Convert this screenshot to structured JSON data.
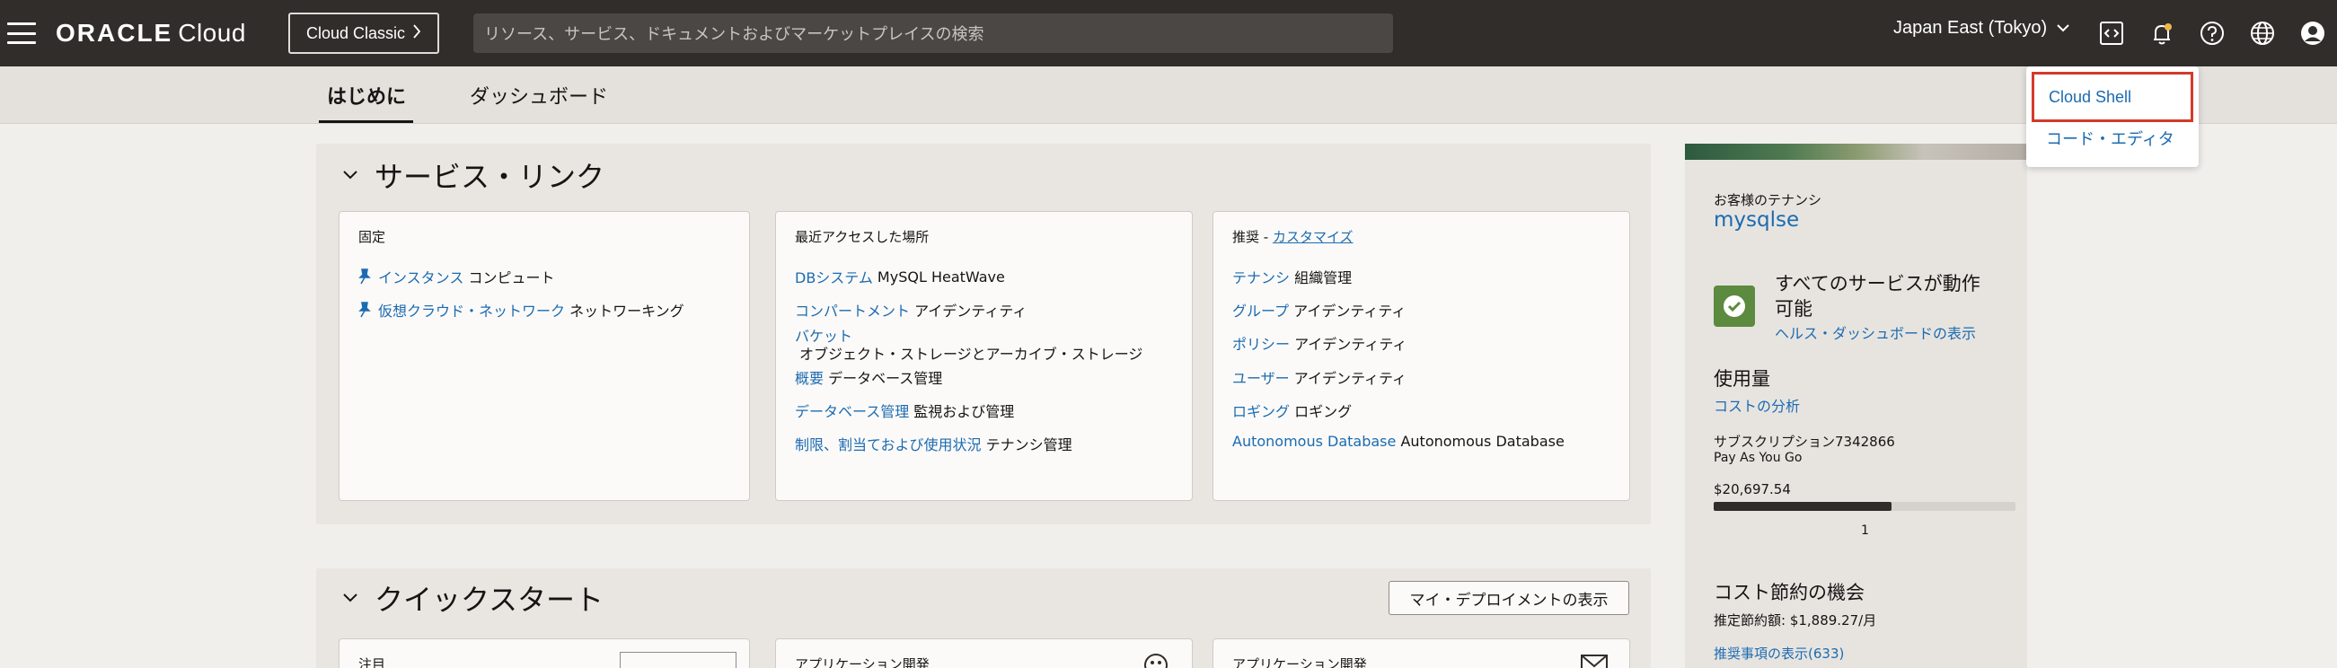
{
  "header": {
    "logo_oracle": "ORACLE",
    "logo_cloud": "Cloud",
    "classic_button": "Cloud Classic",
    "search_placeholder": "リソース、サービス、ドキュメントおよびマーケットプレイスの検索",
    "region": "Japan East (Tokyo)"
  },
  "tabs": [
    {
      "label": "はじめに",
      "active": true
    },
    {
      "label": "ダッシュボード",
      "active": false
    }
  ],
  "service_links": {
    "title": "サービス・リンク",
    "pinned": {
      "header": "固定",
      "items": [
        {
          "link": "インスタンス",
          "category": "コンピュート"
        },
        {
          "link": "仮想クラウド・ネットワーク",
          "category": "ネットワーキング"
        }
      ]
    },
    "recent": {
      "header": "最近アクセスした場所",
      "items": [
        {
          "link": "DBシステム",
          "category": "MySQL HeatWave"
        },
        {
          "link": "コンパートメント",
          "category": "アイデンティティ"
        },
        {
          "link": "バケット",
          "category": "オブジェクト・ストレージとアーカイブ・ストレージ"
        },
        {
          "link": "概要",
          "category": "データベース管理"
        },
        {
          "link": "データベース管理",
          "category": "監視および管理"
        },
        {
          "link": "制限、割当ておよび使用状況",
          "category": "テナンシ管理"
        }
      ]
    },
    "recommended": {
      "header_prefix": "推奨 - ",
      "customize": "カスタマイズ",
      "items": [
        {
          "link": "テナンシ",
          "category": "組織管理"
        },
        {
          "link": "グループ",
          "category": "アイデンティティ"
        },
        {
          "link": "ポリシー",
          "category": "アイデンティティ"
        },
        {
          "link": "ユーザー",
          "category": "アイデンティティ"
        },
        {
          "link": "ロギング",
          "category": "ロギング"
        },
        {
          "link": "Autonomous Database",
          "category": "Autonomous Database"
        }
      ]
    }
  },
  "quickstart": {
    "title": "クイックスタート",
    "deploy_button": "マイ・デプロイメントの表示",
    "cards": [
      {
        "header": "注目"
      },
      {
        "header": "アプリケーション開発"
      },
      {
        "header": "アプリケーション開発"
      }
    ]
  },
  "sidebar": {
    "tenancy_label": "お客様のテナンシ",
    "tenancy_name": "mysqlse",
    "status_line1": "すべてのサービスが動作",
    "status_line2": "可能",
    "health_link": "ヘルス・ダッシュボードの表示",
    "usage_title": "使用量",
    "cost_link": "コストの分析",
    "subscription": "サブスクリプション7342866",
    "plan": "Pay As You Go",
    "amount": "$20,697.54",
    "usage_fraction": 0.59,
    "bar_label": "1",
    "savings_title": "コスト節約の機会",
    "savings_estimate": "推定節約額: $1,889.27/月",
    "recommend_link": "推奨事項の表示(633)"
  },
  "dropdown": {
    "cloud_shell": "Cloud Shell",
    "code_editor": "コード・エディタ"
  },
  "colors": {
    "header_bg": "#312d2a",
    "link": "#1c6bb0",
    "highlight": "#d43a2a",
    "status_green": "#5c8a3e"
  }
}
